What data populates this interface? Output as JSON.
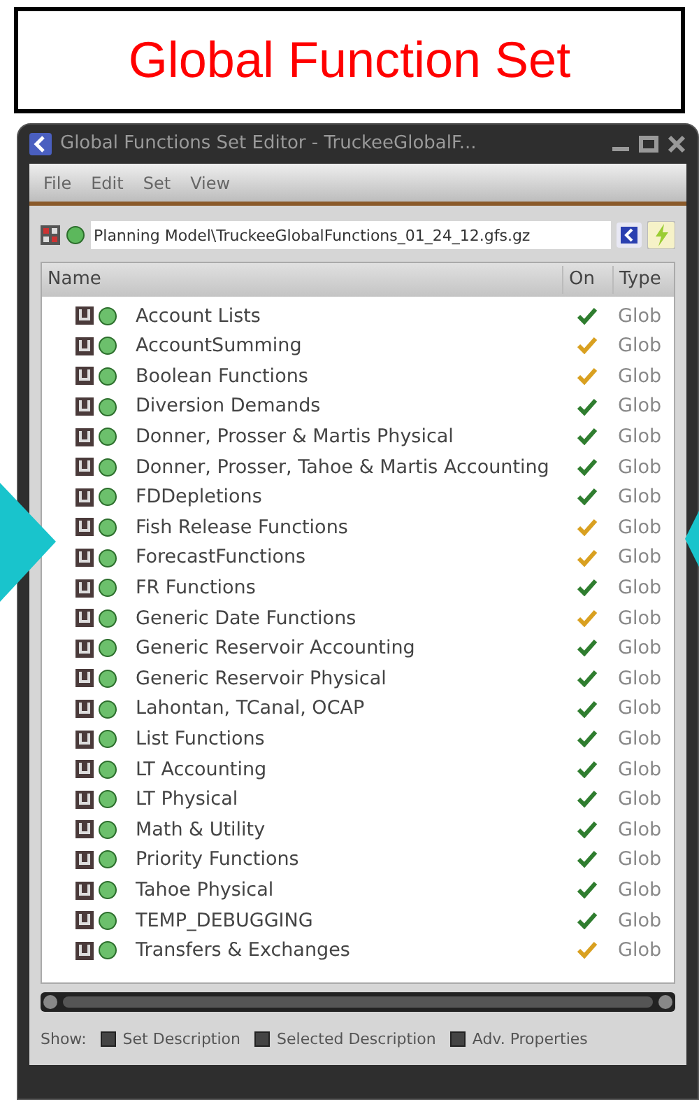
{
  "slide": {
    "title": "Global Function Set"
  },
  "window": {
    "title": "Global Functions Set Editor - TruckeeGlobalF..."
  },
  "menu": [
    "File",
    "Edit",
    "Set",
    "View"
  ],
  "path": {
    "value": "Planning Model\\TruckeeGlobalFunctions_01_24_12.gfs.gz"
  },
  "table": {
    "columns": [
      "Name",
      "On",
      "Type"
    ],
    "rows": [
      {
        "name": "Account Lists",
        "on": true,
        "color": "#2f7d2f",
        "type": "Glob"
      },
      {
        "name": "AccountSumming",
        "on": true,
        "color": "#d9a020",
        "type": "Glob"
      },
      {
        "name": "Boolean Functions",
        "on": true,
        "color": "#d9a020",
        "type": "Glob"
      },
      {
        "name": "Diversion Demands",
        "on": true,
        "color": "#2f7d2f",
        "type": "Glob"
      },
      {
        "name": "Donner, Prosser & Martis Physical",
        "on": true,
        "color": "#2f7d2f",
        "type": "Glob"
      },
      {
        "name": "Donner, Prosser, Tahoe & Martis Accounting",
        "on": true,
        "color": "#2f7d2f",
        "type": "Glob"
      },
      {
        "name": "FDDepletions",
        "on": true,
        "color": "#2f7d2f",
        "type": "Glob"
      },
      {
        "name": "Fish Release Functions",
        "on": true,
        "color": "#d9a020",
        "type": "Glob"
      },
      {
        "name": "ForecastFunctions",
        "on": true,
        "color": "#d9a020",
        "type": "Glob"
      },
      {
        "name": "FR Functions",
        "on": true,
        "color": "#2f7d2f",
        "type": "Glob"
      },
      {
        "name": "Generic Date Functions",
        "on": true,
        "color": "#d9a020",
        "type": "Glob"
      },
      {
        "name": "Generic Reservoir Accounting",
        "on": true,
        "color": "#2f7d2f",
        "type": "Glob"
      },
      {
        "name": "Generic Reservoir Physical",
        "on": true,
        "color": "#2f7d2f",
        "type": "Glob"
      },
      {
        "name": "Lahontan, TCanal, OCAP",
        "on": true,
        "color": "#2f7d2f",
        "type": "Glob"
      },
      {
        "name": "List Functions",
        "on": true,
        "color": "#2f7d2f",
        "type": "Glob"
      },
      {
        "name": "LT Accounting",
        "on": true,
        "color": "#2f7d2f",
        "type": "Glob"
      },
      {
        "name": "LT Physical",
        "on": true,
        "color": "#2f7d2f",
        "type": "Glob"
      },
      {
        "name": "Math & Utility",
        "on": true,
        "color": "#2f7d2f",
        "type": "Glob"
      },
      {
        "name": "Priority Functions",
        "on": true,
        "color": "#2f7d2f",
        "type": "Glob"
      },
      {
        "name": "Tahoe Physical",
        "on": true,
        "color": "#2f7d2f",
        "type": "Glob"
      },
      {
        "name": "TEMP_DEBUGGING",
        "on": true,
        "color": "#2f7d2f",
        "type": "Glob"
      },
      {
        "name": "Transfers & Exchanges",
        "on": true,
        "color": "#d9a020",
        "type": "Glob"
      }
    ]
  },
  "footer": {
    "label": "Show:",
    "options": [
      {
        "label": "Set Description",
        "checked": false
      },
      {
        "label": "Selected Description",
        "checked": false
      },
      {
        "label": "Adv. Properties",
        "checked": false
      }
    ]
  }
}
